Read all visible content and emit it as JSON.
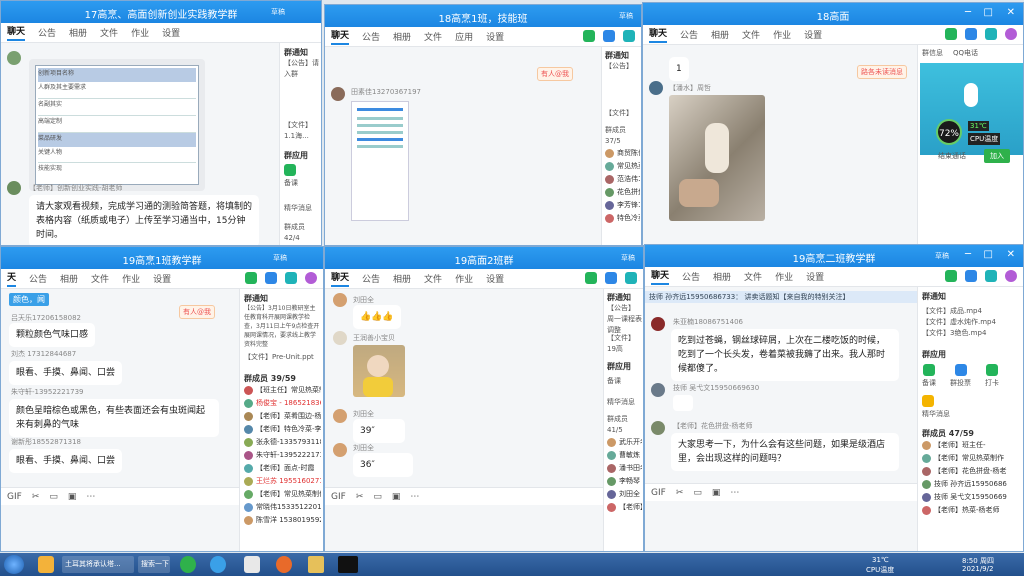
{
  "windows": {
    "w1": {
      "title": "17高烹、高面创新创业实践教学群",
      "pin": "草稿",
      "tabs": [
        "聊天",
        "公告",
        "相册",
        "文件",
        "作业",
        "设置"
      ],
      "messages": [
        {
          "sender": "【老师】创新创业实践-胡老师",
          "text": "请大家观看视频，完成学习通的测验简答题，将填制的表格内容（纸质或电子）上传至学习通当中，15分钟时间。"
        }
      ],
      "table_rows": [
        "创新项目名称",
        "人群及其主要需求",
        "名副其实",
        "高端定制",
        "菜品研发",
        "关键人物",
        "技能实现"
      ],
      "side": {
        "notice_title": "群通知",
        "notice_text": "【公告】请入群",
        "file": "【文件】1.1海...",
        "apps_title": "群应用",
        "apps": [
          "备课",
          "精华消息"
        ],
        "members": "群成员 42/4"
      }
    },
    "w2": {
      "title": "18高烹1班，技能班",
      "pin": "草稿",
      "tabs": [
        "聊天",
        "公告",
        "相册",
        "文件",
        "应用",
        "设置"
      ],
      "at_tag": "有人@我",
      "sender": "田素佳13270367197",
      "side": {
        "notice_title": "群通知",
        "notice_text": "【公告】",
        "file": "【文件】",
        "members": "群成员 37/5",
        "member_list": [
          "商贸陈俊",
          "常见热菜",
          "范浩伟17",
          "花色拼盘",
          "李芳锋18",
          "特色冷菜"
        ]
      }
    },
    "w3": {
      "title": "18高面",
      "tabs": [
        "聊天",
        "公告",
        "相册",
        "文件",
        "作业",
        "设置"
      ],
      "tag": "路各未读消息",
      "msg_num": "1",
      "sender": "【潘水】周哲",
      "side": {
        "tabs": [
          "群信息",
          "QQ电话"
        ],
        "temp": "31℃",
        "temp_label": "CPU温度",
        "percent": "72%",
        "end_btn": "结束通话",
        "join_btn": "加入"
      }
    },
    "w4": {
      "title": "19高烹1班教学群",
      "pin": "草稿",
      "tabs": [
        "天",
        "公告",
        "相册",
        "文件",
        "作业",
        "设置"
      ],
      "top_tag": "颜色，闻",
      "at_tag": "有人@我",
      "messages": [
        {
          "sender": "吕天乐17206158082",
          "text": "颗粒颜色气味口感"
        },
        {
          "sender": "刘杰 17312844687",
          "text": "眼看、手摸、鼻闻、口尝"
        },
        {
          "sender": "朱守轩-13952221739",
          "text": "颜色呈暗棕色或黑色，有些表面还会有虫斑闻起来有刺鼻的气味"
        },
        {
          "sender": "谢新彤18552871318",
          "text": "眼看、手摸、鼻闻、口尝"
        }
      ],
      "side": {
        "notice_title": "群通知",
        "notice_text": "【公告】3月10日教研室主任教育科开展网课教学检查，3月11日上午9点检查开展网课情况，要求线上教学资料完整",
        "file": "【文件】Pre-Unit.ppt",
        "members": "群成员 39/59",
        "member_list": [
          "【班主任】常见热菜制作",
          "杨俊宝 - 18652183629",
          "【老师】菜肴围边-杨老师",
          "【老师】特色冷菜-李老师",
          "张永德-13357931187",
          "朱守轩-13952221739",
          "【老师】面点-时霞",
          "王烂苏 19551602715",
          "【老师】常见热菜制作-杨",
          "常晓伟15335122015",
          "陈雪洋  15380195929"
        ]
      }
    },
    "w5": {
      "title": "19高面2班群",
      "pin": "草稿",
      "tabs": [
        "聊天",
        "公告",
        "相册",
        "文件",
        "作业",
        "设置"
      ],
      "messages": [
        {
          "sender": "刘田全",
          "text": "👍👍👍"
        },
        {
          "sender": "王润善小宝贝",
          "text": ""
        },
        {
          "sender": "刘田全",
          "text": "39″"
        },
        {
          "sender": "刘田全",
          "text": "36″"
        }
      ],
      "side": {
        "notice_title": "群通知",
        "notice_text": "【公告】 周一课程表调整",
        "file": "【文件】19高",
        "apps_title": "群应用",
        "apps": [
          "备课",
          "精华消息"
        ],
        "members": "群成员 41/5",
        "member_list": [
          "武乐开老",
          "曹敏炼",
          "潘书田老",
          "李畅琴",
          "刘田全",
          "【老师】"
        ]
      }
    },
    "w6": {
      "title": "19高烹二班教学群",
      "pin": "草稿",
      "tabs": [
        "聊天",
        "公告",
        "相册",
        "文件",
        "作业",
        "设置"
      ],
      "banner": "技师 孙齐远15950686733：  讲卖话题知【来自我的特别关注】",
      "messages": [
        {
          "sender": "朱亚楠18086751406",
          "text": "吃到过苍蝇，钢丝球碎屑，上次在二楼吃饭的时候，吃到了一个长头发，卷着菜被我薅了出来。我人那时候都傻了。"
        },
        {
          "sender": "技师 吴弋文15950669630",
          "text": ""
        },
        {
          "sender": "【老师】花色拼盘-杨老师",
          "text": "大家思考一下，为什么会有这些问题，如果是级酒店里，会出现这样的问题吗？"
        }
      ],
      "side": {
        "notice_title": "群通知",
        "files": [
          "【文件】成品.mp4",
          "【文件】虚水炖作.mp4",
          "【文件】3绝色.mp4"
        ],
        "apps_title": "群应用",
        "apps": [
          "备课",
          "群投票",
          "打卡",
          "精华消息"
        ],
        "members": "群成员 47/59",
        "member_list": [
          "【老师】班主任-",
          "【老师】常见热菜制作",
          "【老师】花色拼盘-杨老",
          "技师 孙齐远15950686",
          "技师 吴弋文15950669",
          "【老师】热菜-杨老师"
        ]
      }
    }
  },
  "taskbar": {
    "items": [
      "土耳其将承认塔...",
      "搜索一下"
    ],
    "temp": "31℃",
    "temp_label": "CPU温度",
    "time": "8:50 周四",
    "date": "2021/9/2"
  }
}
